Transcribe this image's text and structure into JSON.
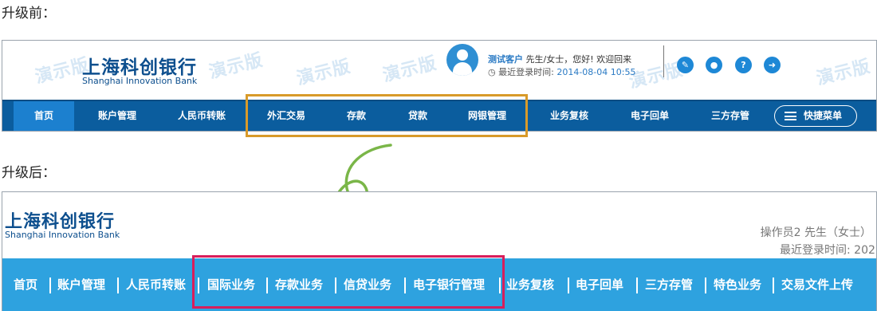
{
  "captions": {
    "before": "升级前：",
    "after": "升级后："
  },
  "before": {
    "watermark_text": "演示版",
    "logo_cn": "上海科创银行",
    "logo_en": "Shanghai Innovation Bank",
    "customer_name": "测试客户",
    "greeting_suffix": "先生/女士，您好! 欢迎回来",
    "login_label": "最近登录时间:",
    "login_time": "2014-08-04 10:55",
    "icons": [
      "edit-icon",
      "location-icon",
      "help-icon",
      "logout-icon"
    ],
    "nav": [
      "首页",
      "账户管理",
      "人民币转账",
      "外汇交易",
      "存款",
      "贷款",
      "网银管理",
      "业务复核",
      "电子回单",
      "三方存管"
    ],
    "quick_menu": "快捷菜单",
    "highlight_color": "#d89a2a",
    "nav_color": "#0b5d9e",
    "active_color": "#1c80cf"
  },
  "after": {
    "logo_cn": "上海科创银行",
    "logo_en": "Shanghai Innovation Bank",
    "operator": "操作员2 先生（女士）",
    "login_label": "最近登录时间: 202",
    "nav": [
      "首页",
      "账户管理",
      "人民币转账",
      "国际业务",
      "存款业务",
      "信贷业务",
      "电子银行管理",
      "业务复核",
      "电子回单",
      "三方存管",
      "特色业务",
      "交易文件上传"
    ],
    "highlight_color": "#d81e5b",
    "nav_color": "#2ea2df"
  },
  "arrow_color": "#7ab648"
}
